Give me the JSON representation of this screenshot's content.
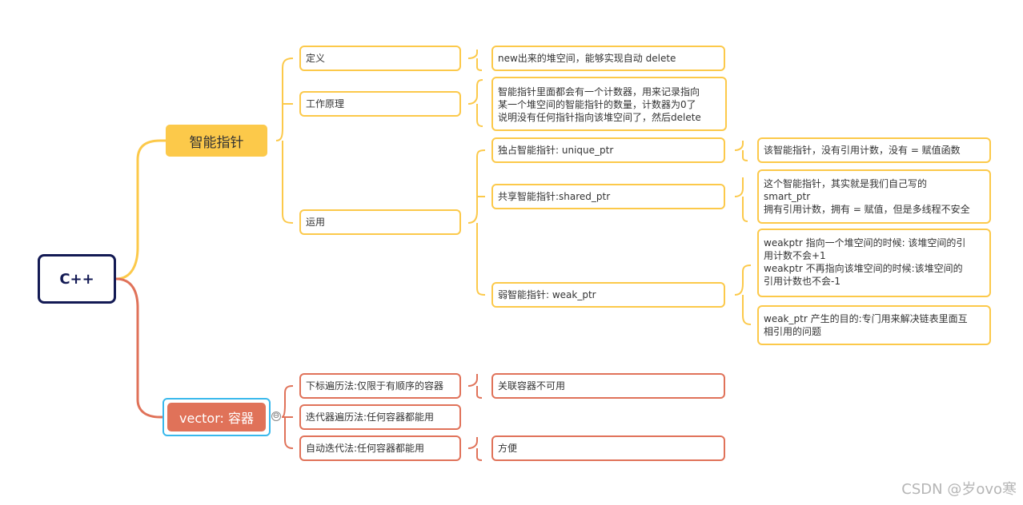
{
  "root": {
    "label": "C++"
  },
  "branch_smart": {
    "label": "智能指针",
    "children": {
      "definition": {
        "label": "定义",
        "detail": "new出来的堆空间，能够实现自动 delete"
      },
      "principle": {
        "label": "工作原理",
        "detail": "智能指针里面都会有一个计数器，用来记录指向\n某一个堆空间的智能指针的数量，计数器为0了\n说明没有任何指针指向该堆空间了，然后delete"
      },
      "usage": {
        "label": "运用",
        "unique": {
          "label": "独占智能指针: unique_ptr",
          "detail": "该智能指针，没有引用计数，没有 = 赋值函数"
        },
        "shared": {
          "label": "共享智能指针:shared_ptr",
          "detail": "这个智能指针，其实就是我们自己写的\nsmart_ptr\n拥有引用计数，拥有 = 赋值，但是多线程不安全"
        },
        "weak": {
          "label": "弱智能指针: weak_ptr",
          "detail1": "weakptr 指向一个堆空间的时候: 该堆空间的引\n用计数不会+1\nweakptr 不再指向该堆空间的时候:该堆空间的\n引用计数也不会-1",
          "detail2": "weak_ptr 产生的目的:专门用来解决链表里面互\n相引用的问题"
        }
      }
    }
  },
  "branch_vector": {
    "label": "vector: 容器",
    "collapse_symbol": "⊖",
    "children": {
      "index": {
        "label": "下标遍历法:仅限于有顺序的容器",
        "detail": "关联容器不可用"
      },
      "iterator": {
        "label": "迭代器遍历法:任何容器都能用"
      },
      "auto": {
        "label": "自动迭代法:任何容器都能用",
        "detail": "方便"
      }
    }
  },
  "watermark": "CSDN @岁ovo寒",
  "colors": {
    "smart_branch": "#fcc94a",
    "vector_branch": "#e07259",
    "root_border": "#131a54",
    "selection": "#39b8ec"
  }
}
